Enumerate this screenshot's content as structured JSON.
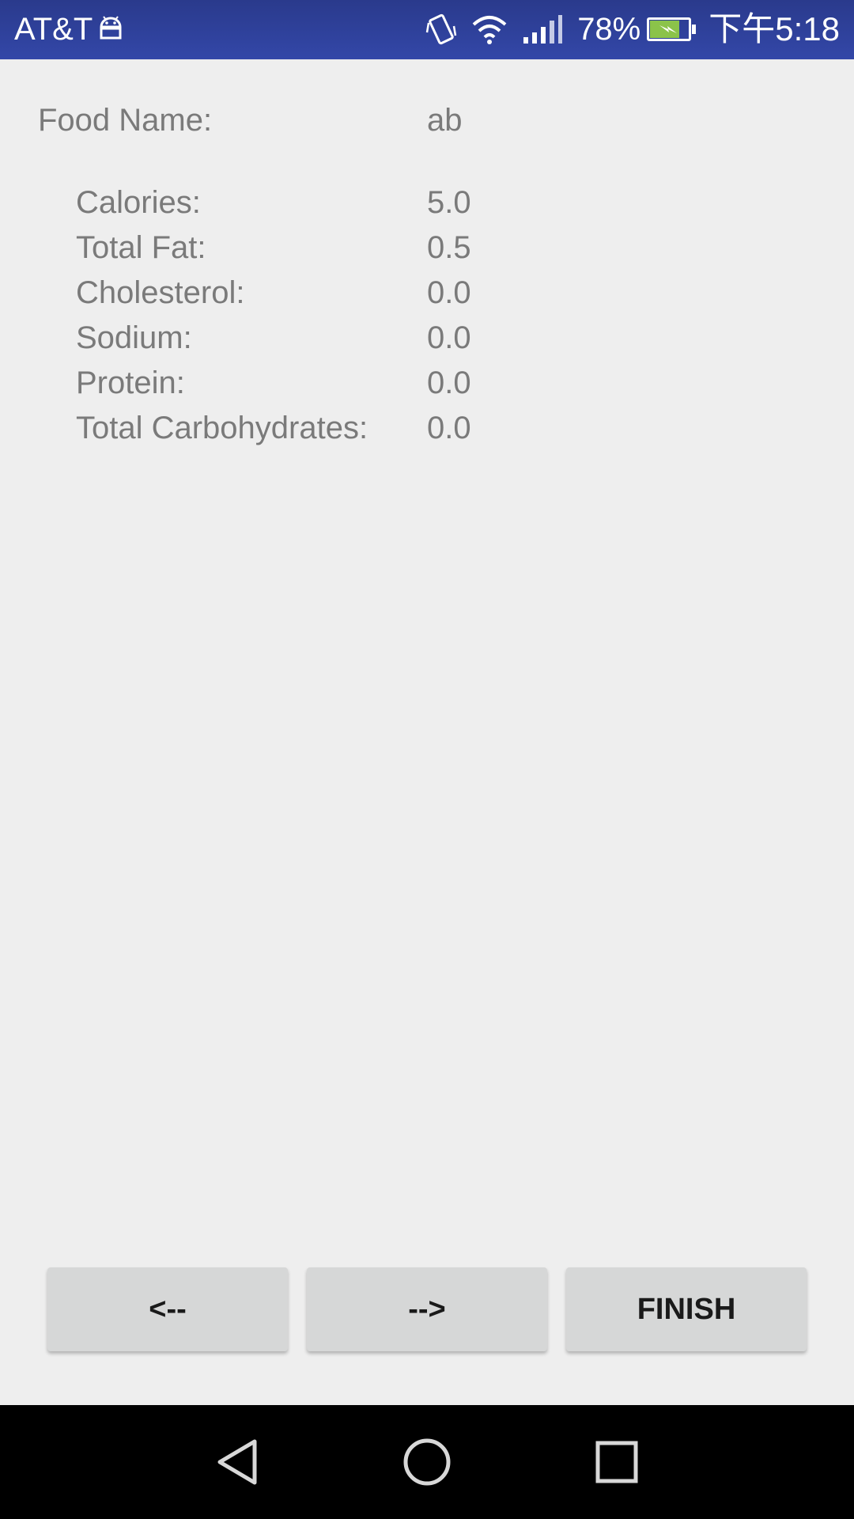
{
  "status_bar": {
    "carrier": "AT&T",
    "battery_percent": "78%",
    "battery_level": 0.78,
    "time": "下午5:18",
    "icons": [
      "android-icon",
      "vibrate-icon",
      "wifi-icon",
      "signal-icon",
      "battery-charging-icon"
    ],
    "battery_fill_color": "#8bc34a"
  },
  "food": {
    "name_label": "Food Name:",
    "name_value": "ab"
  },
  "nutrients": [
    {
      "label": "Calories:",
      "value": "5.0"
    },
    {
      "label": "Total Fat:",
      "value": "0.5"
    },
    {
      "label": "Cholesterol:",
      "value": "0.0"
    },
    {
      "label": "Sodium:",
      "value": "0.0"
    },
    {
      "label": "Protein:",
      "value": "0.0"
    },
    {
      "label": "Total Carbohydrates:",
      "value": "0.0"
    }
  ],
  "buttons": {
    "prev_label": "<--",
    "next_label": "-->",
    "finish_label": "FINISH"
  },
  "nav_bar": {
    "icons": [
      "back-icon",
      "home-icon",
      "recents-icon"
    ]
  }
}
